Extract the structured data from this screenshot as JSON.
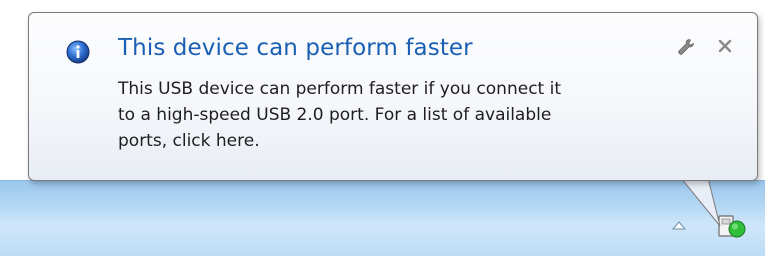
{
  "notification": {
    "title": "This device can perform faster",
    "body_lines": [
      "This USB device can perform faster if you connect it",
      "to a high-speed USB 2.0 port. For a list of available",
      "ports, click here."
    ],
    "icons": {
      "info": "info-icon",
      "options": "wrench-icon",
      "close": "close-icon"
    },
    "colors": {
      "title": "#1a5fb4",
      "body": "#1e1e1e",
      "info_icon": "#2f6fd1"
    }
  },
  "taskbar": {
    "tray_icons": [
      "show-hidden-icons-arrow",
      "usb-device-icon"
    ]
  }
}
